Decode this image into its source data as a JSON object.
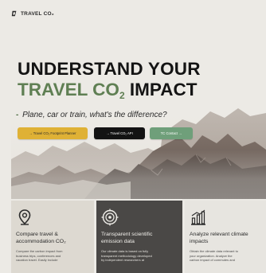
{
  "brand": {
    "name": "TRAVEL CO₂"
  },
  "hero": {
    "line1": "UNDERSTAND YOUR",
    "line2_prefix": "TRAVEL CO",
    "line2_sub": "2",
    "line2_suffix": " IMPACT",
    "tagline_dash": "-",
    "tagline": "Plane, car or train, what's the difference?"
  },
  "buttons": {
    "primary": "→ Travel CO₂ Footprint Planner",
    "secondary": "→ Travel CO₂ API",
    "tertiary": "TC Contact →"
  },
  "cards": [
    {
      "icon": "map-pin-icon",
      "title_line1": "Compare travel &",
      "title_line2": "accommodation CO₂",
      "text_line1": "Compare the carbon impact from",
      "text_line2": "business trips, conferences and",
      "text_line3": "vacation travel. Easily include"
    },
    {
      "icon": "target-icon",
      "title_line1": "Transparent scientific",
      "title_line2": "emission data",
      "text_line1": "Our climate data is based on fully",
      "text_line2": "transparent methodology developed",
      "text_line3": "by independent researchers at"
    },
    {
      "icon": "bar-chart-icon",
      "title_line1": "Analyze relevant climate",
      "title_line2": "impacts",
      "text_line1": "Obtain the climate data relevant to",
      "text_line2": "your organization. Analyze the",
      "text_line3": "carbon impact of commutes and"
    }
  ],
  "colors": {
    "accent_green": "#5f7f53",
    "button_yellow": "#dfb135",
    "button_dark": "#131313",
    "button_green": "#6f9f7a",
    "card_dark": "#4a4846"
  }
}
